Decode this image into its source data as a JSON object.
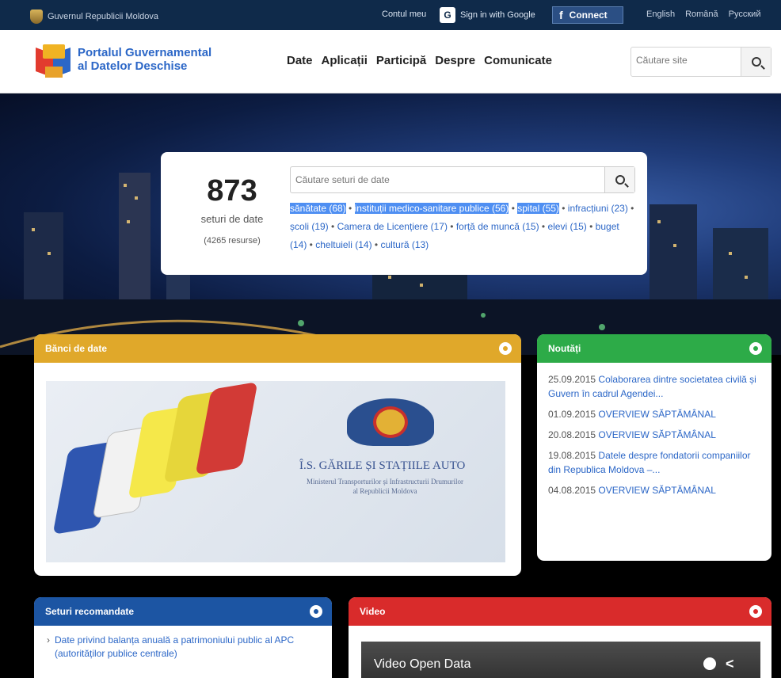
{
  "topbar": {
    "gov_label": "Guvernul Republicii Moldova",
    "account": "Contul meu",
    "google": "Sign in with Google",
    "facebook": "Connect",
    "languages": [
      "English",
      "Română",
      "Русский"
    ]
  },
  "header": {
    "brand_line1": "Portalul Guvernamental",
    "brand_line2": "al Datelor Deschise",
    "nav": [
      "Date",
      "Aplicații",
      "Participă",
      "Despre",
      "Comunicate"
    ],
    "search_placeholder": "Căutare site"
  },
  "hero": {
    "count": "873",
    "count_label": "seturi de date",
    "resources": "(4265 resurse)",
    "search_placeholder": "Căutare seturi de date",
    "tags": [
      {
        "label": "sănătate (68)",
        "highlight": true
      },
      {
        "label": "instituții medico-sanitare publice (56)",
        "highlight": true
      },
      {
        "label": "spital (55)",
        "highlight": true
      },
      {
        "label": "infracțiuni (23)"
      },
      {
        "label": "școli (19)"
      },
      {
        "label": "Camera de Licențiere (17)"
      },
      {
        "label": "forță de muncă (15)"
      },
      {
        "label": "elevi (15)"
      },
      {
        "label": "buget (14)"
      },
      {
        "label": "cheltuieli (14)"
      },
      {
        "label": "cultură (13)"
      }
    ]
  },
  "banks": {
    "title": "Bănci de date",
    "banner_title": "Î.S. GĂRILE ȘI STAȚIILE AUTO",
    "banner_sub1": "Ministerul Transporturilor și Infrastructurii Drumurilor",
    "banner_sub2": "al Republicii Moldova"
  },
  "news": {
    "title": "Noutăți",
    "items": [
      {
        "date": "25.09.2015",
        "text": "Colaborarea dintre societatea civilă și Guvern în cadrul Agendei..."
      },
      {
        "date": "01.09.2015",
        "text": "OVERVIEW SĂPTĂMÂNAL"
      },
      {
        "date": "20.08.2015",
        "text": "OVERVIEW SĂPTĂMÂNAL"
      },
      {
        "date": "19.08.2015",
        "text": "Datele despre fondatorii companiilor din Republica Moldova –..."
      },
      {
        "date": "04.08.2015",
        "text": "OVERVIEW SĂPTĂMÂNAL"
      }
    ]
  },
  "recommended": {
    "title": "Seturi recomandate",
    "item": "Date privind balanța anuală a patrimoniului public al APC (autorităților publice centrale)"
  },
  "video": {
    "title": "Video",
    "player_title": "Video Open Data"
  },
  "colors": {
    "topbar": "#0f2a4a",
    "brand_blue": "#2c67c7",
    "banks": "#e0a82a",
    "news": "#2dab48",
    "recommended": "#1c55a3",
    "video": "#d92b2b"
  }
}
